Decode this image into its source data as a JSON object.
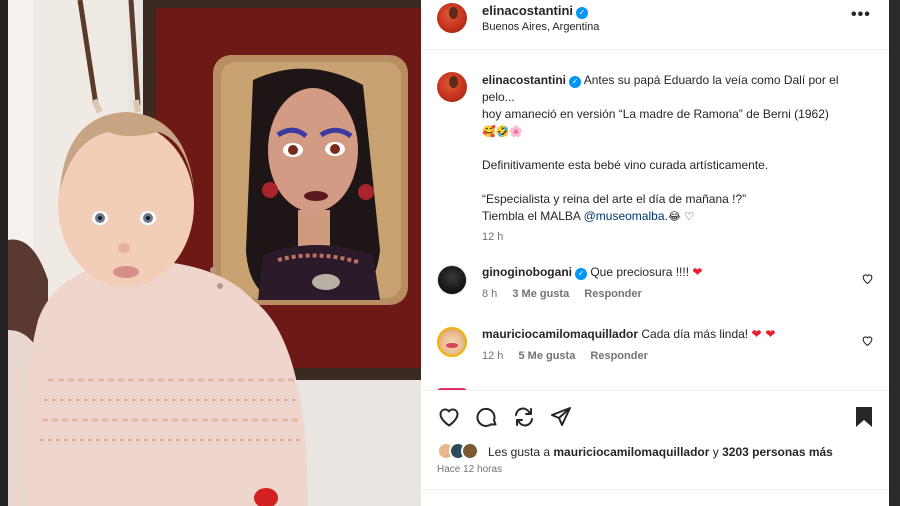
{
  "post": {
    "author": "elinacostantini",
    "location": "Buenos Aires, Argentina",
    "more_icon": "•••"
  },
  "caption": {
    "user": "elinacostantini",
    "line1": "Antes su papá Eduardo la veía como Dalí por el pelo...",
    "line2": "hoy amaneció en versión “La madre de Ramona” de Berni (1962)",
    "line3_emoji": "🥰🤣🌸",
    "line4": "Definitivamente esta bebé vino curada artísticamente.",
    "line5": "“Especialista y reina del arte el día de mañana !?”",
    "line6_prefix": "Tiembla el MALBA ",
    "mention": "@museomalba",
    "line6_suffix": " .😂 ♡",
    "time": "12 h"
  },
  "comments": [
    {
      "user": "ginoginobogani",
      "text": "Que preciosura !!!!",
      "heart": "❤",
      "time": "8 h",
      "likes": "3 Me gusta",
      "reply": "Responder"
    },
    {
      "user": "mauriciocamilomaquillador",
      "text": "Cada día más linda!",
      "heart": "❤ ❤",
      "time": "12 h",
      "likes": "5 Me gusta",
      "reply": "Responder"
    }
  ],
  "likes": {
    "prefix": "Les gusta a ",
    "user": "mauriciocamilomaquillador",
    "middle": " y ",
    "others": "3203 personas más"
  },
  "post_time": "Hace 12 horas",
  "colors": {
    "verified": "#0095f6",
    "heart": "#ed1b2e",
    "muted": "#737373",
    "mention": "#00376b"
  }
}
